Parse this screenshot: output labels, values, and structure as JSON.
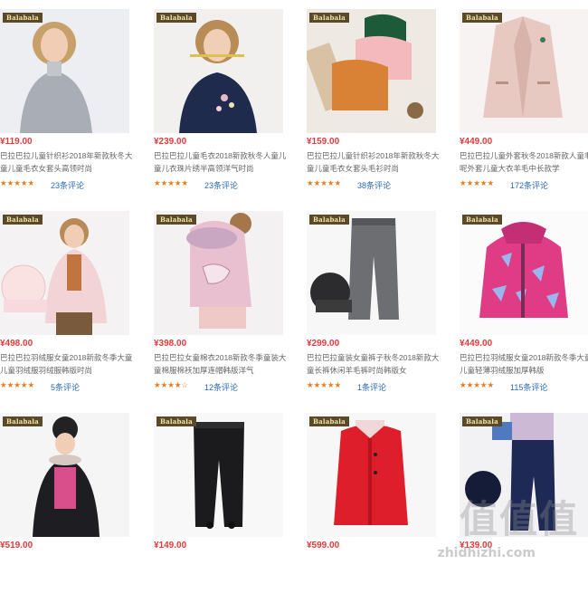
{
  "brand_logo": "Balabala",
  "products": [
    {
      "price": "¥119.00",
      "title": "巴拉巴拉儿童针织衫2018年新款秋冬大童儿童毛衣女套头高领时尚",
      "stars": "★★★★★",
      "reviews": "23条评论",
      "icon": "girl-gray-sweater"
    },
    {
      "price": "¥239.00",
      "title": "巴拉巴拉儿童毛衣2018新款秋冬人童儿童儿衣珠片绣半高领洋气时尚",
      "stars": "★★★★★",
      "reviews": "23条评论",
      "icon": "girl-navy-sweater"
    },
    {
      "price": "¥159.00",
      "title": "巴拉巴拉儿童针织衫2018年新款秋冬大童儿童毛衣女套头毛衫时尚",
      "stars": "★★★★★",
      "reviews": "38条评论",
      "icon": "folded-sweaters"
    },
    {
      "price": "¥449.00",
      "title": "巴拉巴拉儿童外套秋冬2018新款人童毛呢外套儿童大衣羊毛中长款学",
      "stars": "★★★★★",
      "reviews": "172条评论",
      "icon": "pink-coat"
    },
    {
      "price": "¥498.00",
      "title": "巴拉巴拉羽绒服女童2018新款冬季大童儿童羽绒服羽绒服韩版时尚",
      "stars": "★★★★★",
      "reviews": "5条评论",
      "icon": "girl-pink-down-jacket"
    },
    {
      "price": "¥398.00",
      "title": "巴拉巴拉女童棉衣2018新款冬季童装大童棉服棉袄加厚连帽韩版洋气",
      "stars": "★★★★☆",
      "reviews": "12条评论",
      "icon": "girl-pink-hooded-coat"
    },
    {
      "price": "¥299.00",
      "title": "巴拉巴拉童装女童裤子秋冬2018新款大童长裤休闲羊毛裤时尚韩版女",
      "stars": "★★★★★",
      "reviews": "1条评论",
      "icon": "gray-pants"
    },
    {
      "price": "¥449.00",
      "title": "巴拉巴拉羽绒服女童2018新款冬季大童儿童轻薄羽绒服加厚韩版",
      "stars": "★★★★★",
      "reviews": "115条评论",
      "icon": "pink-pattern-jacket"
    },
    {
      "price": "¥519.00",
      "title": "",
      "stars": "",
      "reviews": "",
      "icon": "girl-black-parka"
    },
    {
      "price": "¥149.00",
      "title": "",
      "stars": "",
      "reviews": "",
      "icon": "black-leggings"
    },
    {
      "price": "¥599.00",
      "title": "",
      "stars": "",
      "reviews": "",
      "icon": "red-coat"
    },
    {
      "price": "¥139.00",
      "title": "",
      "stars": "",
      "reviews": "",
      "icon": "girl-navy-pants"
    }
  ],
  "watermark": "值值值",
  "watermark_url": "zhidhizhi.com"
}
